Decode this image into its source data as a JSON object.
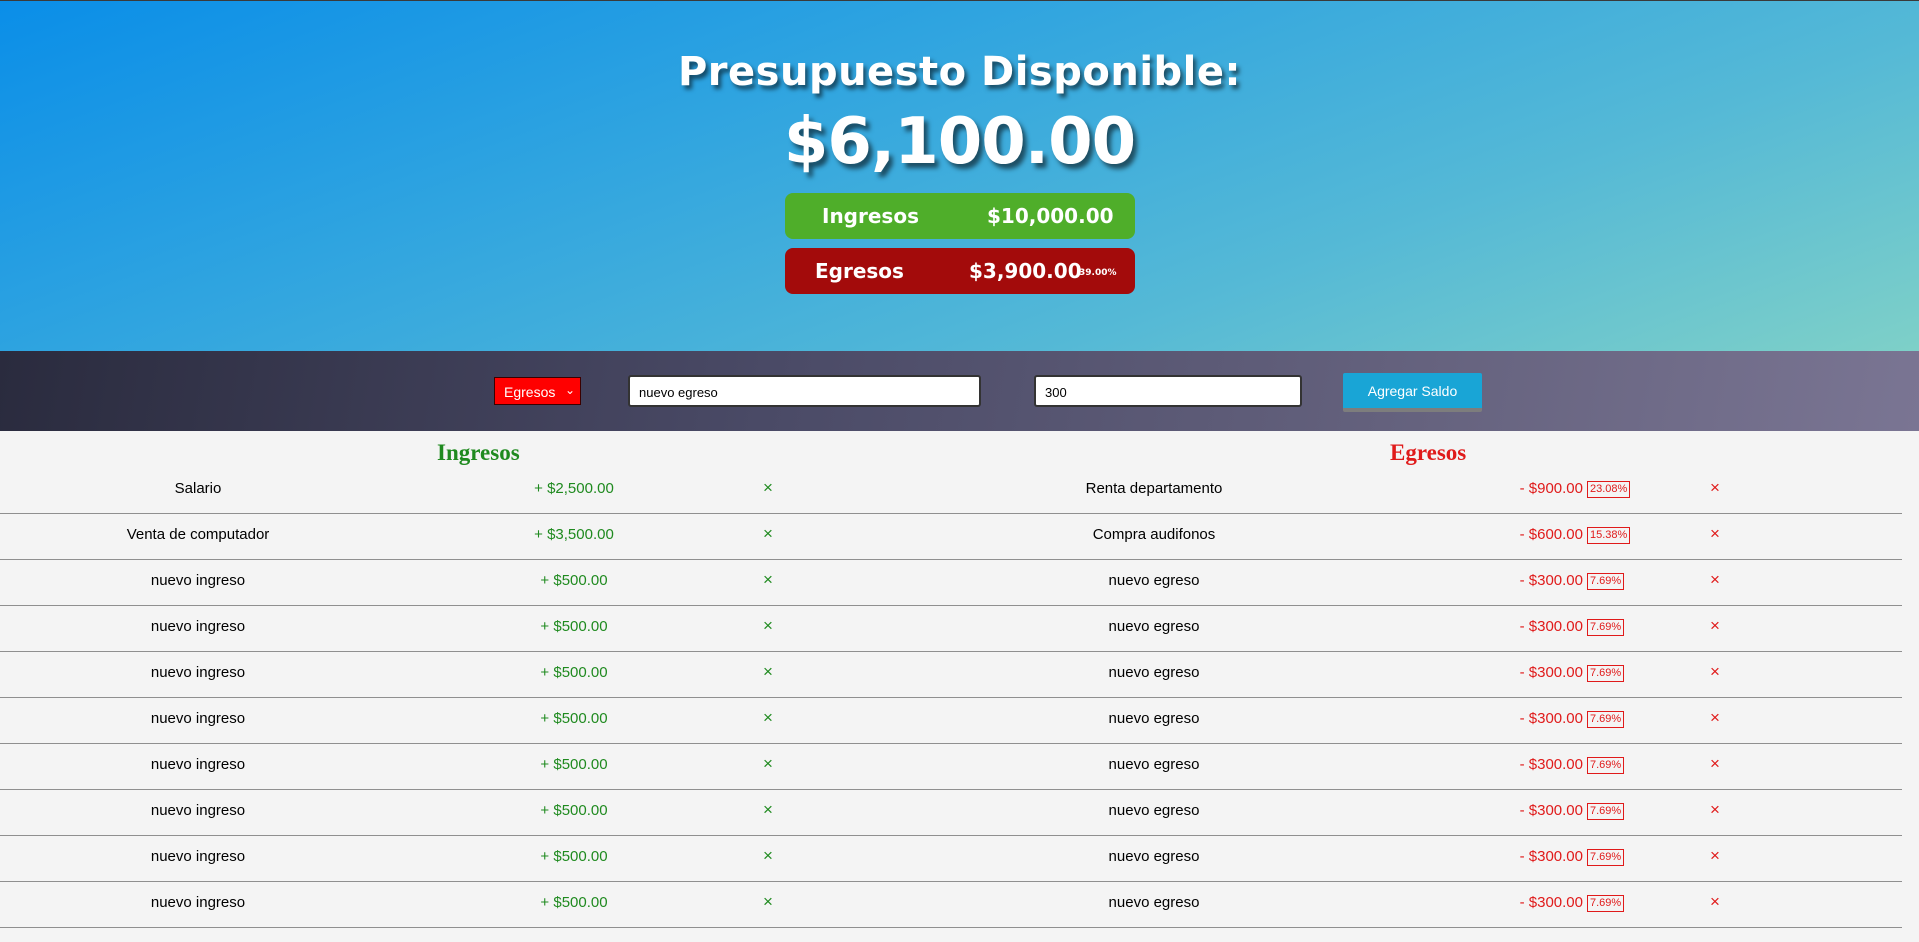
{
  "header": {
    "title": "Presupuesto Disponible:",
    "total": "$6,100.00",
    "ingresos_label": "Ingresos",
    "ingresos_total": "$10,000.00",
    "egresos_label": "Egresos",
    "egresos_total": "$3,900.00",
    "egresos_percent": "39.00%"
  },
  "form": {
    "type_selected": "Egresos",
    "description_value": "nuevo egreso",
    "amount_value": "300",
    "submit_label": "Agregar Saldo"
  },
  "ingresos": {
    "title": "Ingresos",
    "items": [
      {
        "description": "Salario",
        "value": "+ $2,500.00"
      },
      {
        "description": "Venta de computador",
        "value": "+ $3,500.00"
      },
      {
        "description": "nuevo ingreso",
        "value": "+ $500.00"
      },
      {
        "description": "nuevo ingreso",
        "value": "+ $500.00"
      },
      {
        "description": "nuevo ingreso",
        "value": "+ $500.00"
      },
      {
        "description": "nuevo ingreso",
        "value": "+ $500.00"
      },
      {
        "description": "nuevo ingreso",
        "value": "+ $500.00"
      },
      {
        "description": "nuevo ingreso",
        "value": "+ $500.00"
      },
      {
        "description": "nuevo ingreso",
        "value": "+ $500.00"
      },
      {
        "description": "nuevo ingreso",
        "value": "+ $500.00"
      }
    ]
  },
  "egresos": {
    "title": "Egresos",
    "items": [
      {
        "description": "Renta departamento",
        "value": "- $900.00",
        "percent": "23.08%"
      },
      {
        "description": "Compra audifonos",
        "value": "- $600.00",
        "percent": "15.38%"
      },
      {
        "description": "nuevo egreso",
        "value": "- $300.00",
        "percent": "7.69%"
      },
      {
        "description": "nuevo egreso",
        "value": "- $300.00",
        "percent": "7.69%"
      },
      {
        "description": "nuevo egreso",
        "value": "- $300.00",
        "percent": "7.69%"
      },
      {
        "description": "nuevo egreso",
        "value": "- $300.00",
        "percent": "7.69%"
      },
      {
        "description": "nuevo egreso",
        "value": "- $300.00",
        "percent": "7.69%"
      },
      {
        "description": "nuevo egreso",
        "value": "- $300.00",
        "percent": "7.69%"
      },
      {
        "description": "nuevo egreso",
        "value": "- $300.00",
        "percent": "7.69%"
      },
      {
        "description": "nuevo egreso",
        "value": "- $300.00",
        "percent": "7.69%"
      }
    ]
  },
  "icons": {
    "delete": "×"
  },
  "colors": {
    "income": "#1f8a1f",
    "expense": "#e01a1a",
    "income_pill": "#4fae2a",
    "expense_pill": "#a30b0b"
  }
}
